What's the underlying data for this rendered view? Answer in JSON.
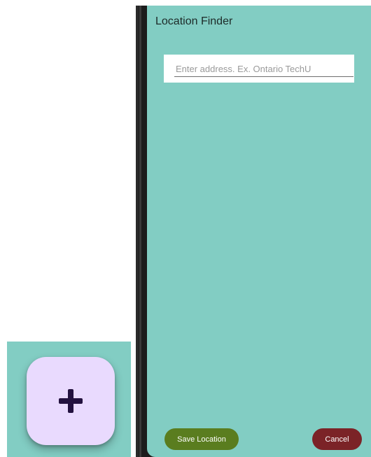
{
  "fab": {
    "icon": "plus-icon",
    "background_color": "#e9dafe",
    "icon_color": "#23113f"
  },
  "app": {
    "title": "Location Finder",
    "background_color": "#82cdc3"
  },
  "address": {
    "value": "",
    "placeholder": "Enter address. Ex. Ontario TechU"
  },
  "actions": {
    "save_label": "Save Location",
    "save_color": "#5a7d1f",
    "cancel_label": "Cancel",
    "cancel_color": "#7b2327"
  }
}
